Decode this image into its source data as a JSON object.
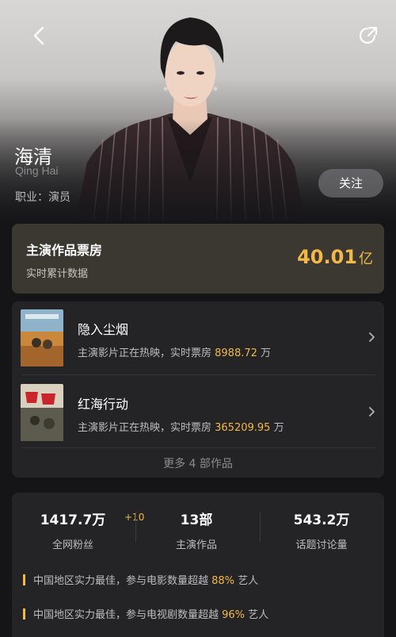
{
  "profile": {
    "name": "海清",
    "name_en": "Qing Hai",
    "occupation": "职业：演员",
    "follow_label": "关注"
  },
  "box_office": {
    "title": "主演作品票房",
    "subtitle": "实时累计数据",
    "value": "40.01",
    "unit": "亿"
  },
  "works": {
    "items": [
      {
        "title": "隐入尘烟",
        "desc_prefix": "主演影片正在热映，实时票房 ",
        "box_office": "8988.72",
        "unit": "万"
      },
      {
        "title": "红海行动",
        "desc_prefix": "主演影片正在热映，实时票房 ",
        "box_office": "365209.95",
        "unit": "万"
      }
    ],
    "more_label": "更多 4 部作品"
  },
  "stats": {
    "items": [
      {
        "value": "1417.7万",
        "label": "全网粉丝",
        "badge": "+10"
      },
      {
        "value": "13部",
        "label": "主演作品"
      },
      {
        "value": "543.2万",
        "label": "话题讨论量"
      }
    ],
    "facts": [
      {
        "prefix": "中国地区实力最佳，参与电影数量超越 ",
        "percent": "88%",
        "suffix": " 艺人"
      },
      {
        "prefix": "中国地区实力最佳，参与电视剧数量超越 ",
        "percent": "96%",
        "suffix": " 艺人"
      }
    ]
  },
  "colors": {
    "accent_gold": "#f2b949",
    "background": "#151517",
    "card": "#242427",
    "box_office_card": "#3b3831"
  },
  "icons": [
    "back-arrow-icon",
    "share-icon",
    "chevron-right-icon"
  ]
}
